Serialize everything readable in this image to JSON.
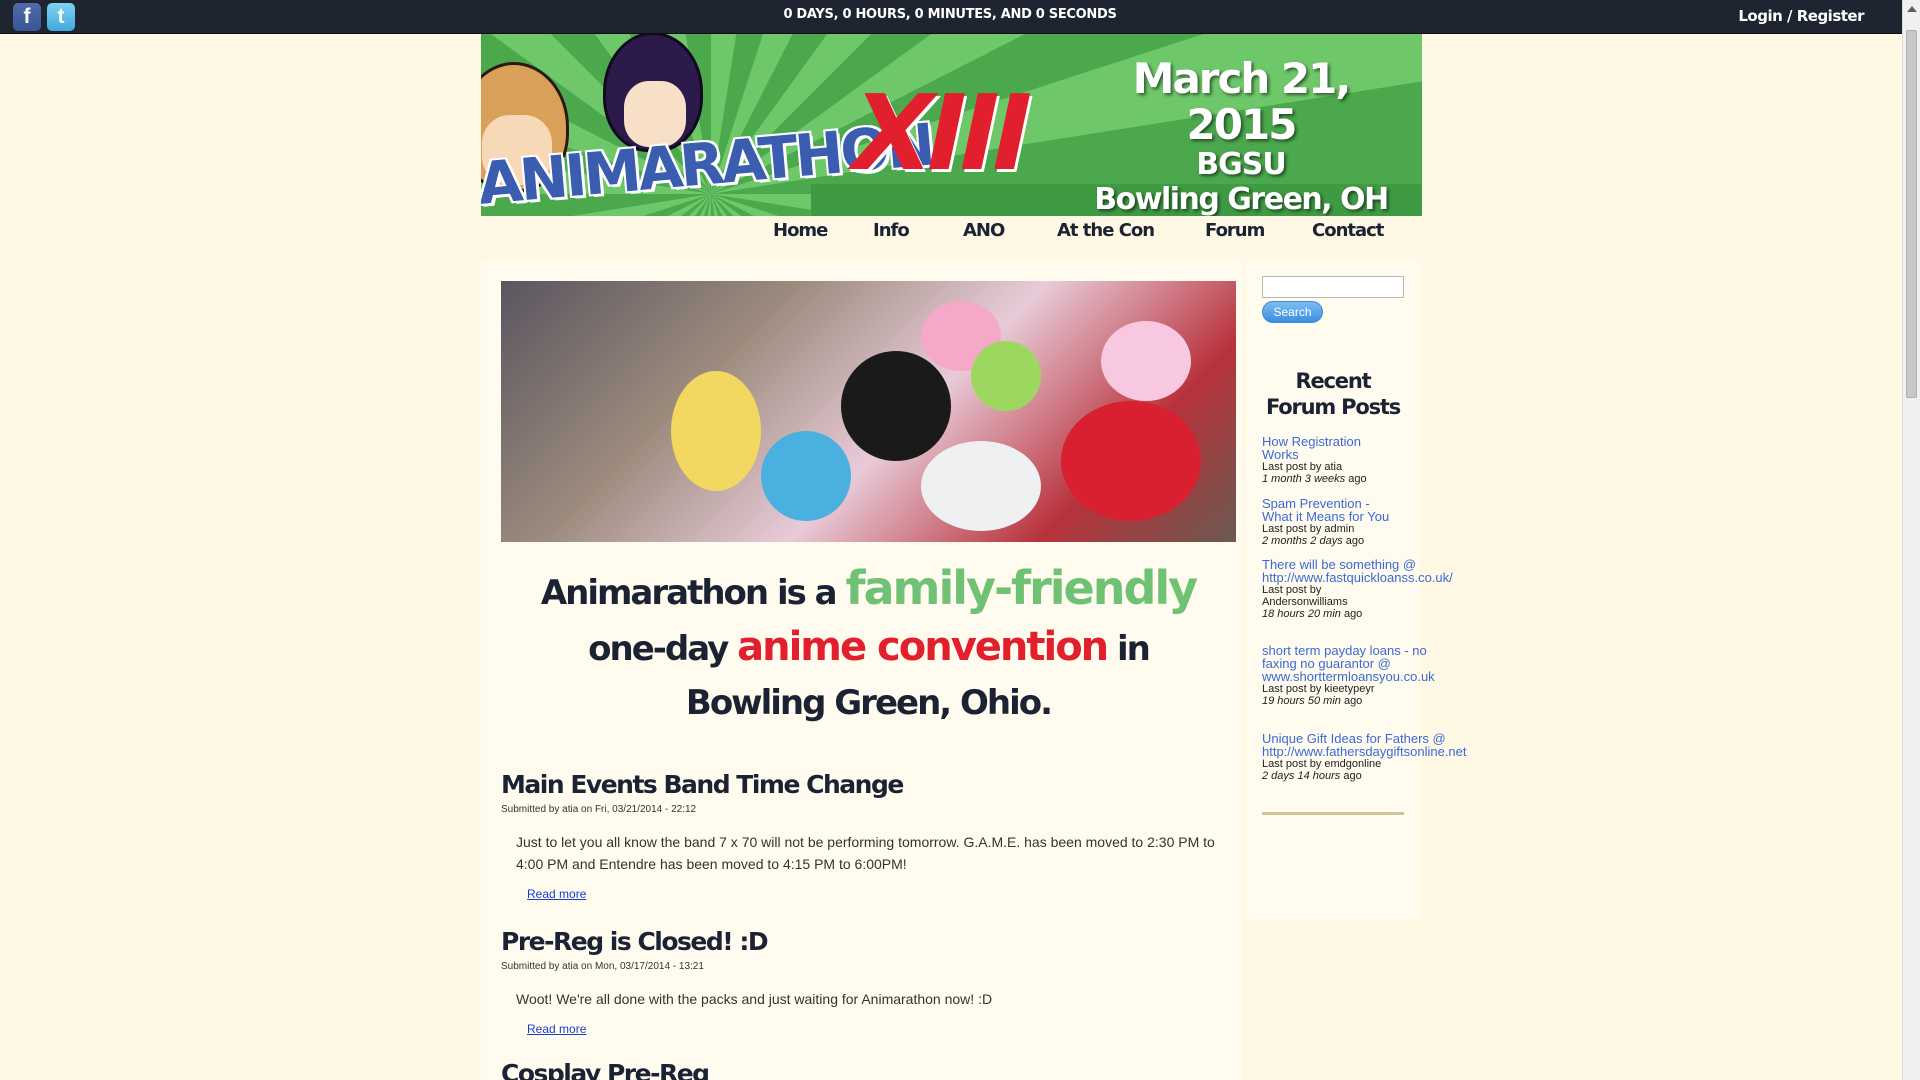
{
  "topbar": {
    "social": [
      {
        "name": "facebook",
        "glyph": "f",
        "icon": "facebook-icon"
      },
      {
        "name": "twitter",
        "glyph": "t",
        "icon": "twitter-icon"
      }
    ],
    "countdown": "0 DAYS, 0 HOURS, 0 MINUTES, AND 0 SECONDS",
    "login": "Login / Register"
  },
  "banner": {
    "logo_text": "ANIMARATHON",
    "logo_number": "XIII",
    "date": "March 21, 2015",
    "venue": "BGSU",
    "city": "Bowling Green, OH"
  },
  "nav": {
    "items": [
      "Home",
      "Info",
      "ANO",
      "At the Con",
      "Forum",
      "Contact"
    ]
  },
  "tagline": {
    "part1": "Animarathon is a ",
    "highlight1": "family-friendly",
    "part2": "one-day ",
    "highlight2": "anime convention",
    "part3": " in",
    "part4": "Bowling Green, Ohio."
  },
  "posts": [
    {
      "title": "Main Events Band Time Change",
      "meta": "Submitted by atia on Fri, 03/21/2014 - 22:12",
      "body": "Just to let you all know the band 7 x 70 will not be performing tomorrow.  G.A.M.E. has been moved to 2:30 PM to 4:00 PM and Entendre has been moved to 4:15 PM to 6:00PM!",
      "read_more": "Read more"
    },
    {
      "title": "Pre-Reg is Closed! :D",
      "meta": "Submitted by atia on Mon, 03/17/2014 - 13:21",
      "body": "Woot! We're all done with the packs and just waiting for Animarathon now! :D",
      "read_more": "Read more"
    },
    {
      "title": "Cosplay Pre-Reg"
    }
  ],
  "sidebar": {
    "search_button": "Search",
    "search_value": "",
    "recent_title_1": "Recent",
    "recent_title_2": "Forum Posts",
    "forum_posts": [
      {
        "link": "How Registration Works",
        "by": "Last post by atia",
        "age": "1 month 3 weeks",
        "ago": " ago"
      },
      {
        "link": "Spam Prevention - What it Means for You",
        "by": "Last post by admin",
        "age": "2 months 2 days",
        "ago": " ago"
      },
      {
        "link": "There will be something @ http://www.fastquickloanss.co.uk/",
        "by": "Last post by Andersonwilliams",
        "age": "18 hours 20 min",
        "ago": " ago"
      },
      {
        "link": "short term payday loans - no faxing no guarantor @ www.shorttermloansyou.co.uk",
        "by": "Last post by kieetypeyr",
        "age": "19 hours 50 min",
        "ago": " ago"
      },
      {
        "link": "Unique Gift Ideas for Fathers @ http://www.fathersdaygiftsonline.net",
        "by": "Last post by emdgonline",
        "age": "2 days 14 hours",
        "ago": " ago"
      }
    ]
  },
  "colors": {
    "page_bg": "#fef8e4",
    "topbar_bg": "#1e2530",
    "accent_green": "#6fc174",
    "accent_red": "#e21f2d",
    "link_blue": "#3b6ad6",
    "heading": "#1b2233"
  }
}
